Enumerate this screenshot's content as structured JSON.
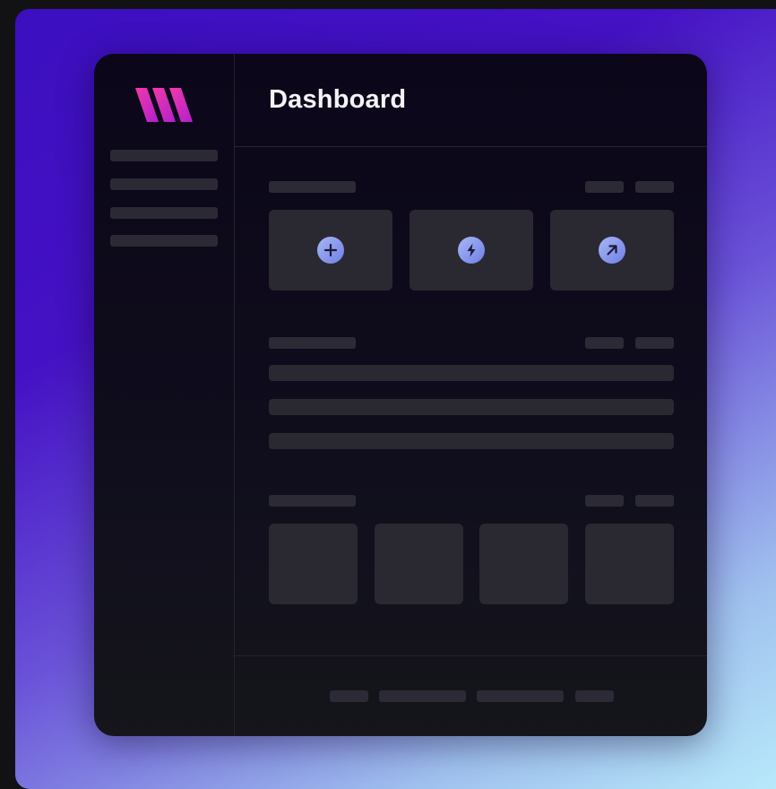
{
  "header": {
    "title": "Dashboard"
  },
  "logo": {
    "icon": "brand-w-logo",
    "color": "#e02fb1"
  },
  "sidebar": {
    "placeholder_item_count": 4
  },
  "quick_actions": [
    {
      "icon": "plus-icon"
    },
    {
      "icon": "lightning-bolt-icon"
    },
    {
      "icon": "arrow-up-right-icon"
    }
  ],
  "colors": {
    "accent_icon": "#8b98ee",
    "background_gradient_start": "#3b0fbf",
    "background_gradient_end": "#b9ebfb",
    "window_background": "#0d0a1b",
    "placeholder": "#2a2932"
  }
}
